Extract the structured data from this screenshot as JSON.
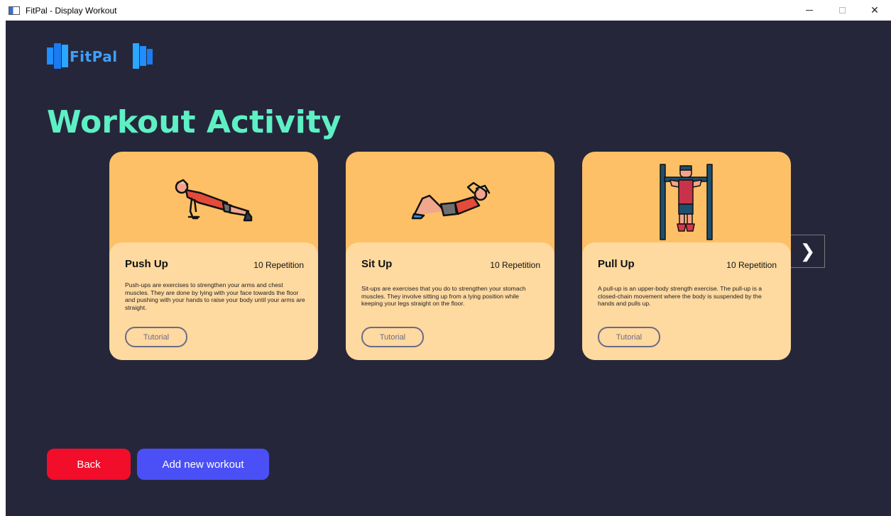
{
  "window": {
    "title": "FitPal - Display Workout",
    "controls": {
      "minimize": "",
      "maximize": "",
      "close": "✕"
    }
  },
  "logo": {
    "text": "FitPal"
  },
  "page": {
    "heading": "Workout Activity"
  },
  "cards": [
    {
      "name": "Push Up",
      "reps": "10 Repetition",
      "description": "Push-ups are exercises to strengthen your arms and chest muscles. They are done by lying with your face towards the floor and pushing with your hands to raise your body until your arms are straight.",
      "button": "Tutorial",
      "icon": "push-up-icon"
    },
    {
      "name": "Sit Up",
      "reps": "10 Repetition",
      "description": "Sit-ups are exercises that you do to strengthen your stomach muscles. They involve sitting up from a lying position while keeping your legs straight on the floor.",
      "button": "Tutorial",
      "icon": "sit-up-icon"
    },
    {
      "name": "Pull Up",
      "reps": "10 Repetition",
      "description": "A pull-up is an upper-body strength exercise. The pull-up is a closed-chain movement where the body is suspended by the hands and pulls up.",
      "button": "Tutorial",
      "icon": "pull-up-icon"
    }
  ],
  "carousel": {
    "next": "❯"
  },
  "actions": {
    "back": "Back",
    "add": "Add new workout"
  },
  "colors": {
    "background": "#26263b",
    "heading": "#5ef0c4",
    "card_top": "#fdc066",
    "card_body": "#fed9a0",
    "back": "#f20d2a",
    "add": "#4a50f6"
  }
}
